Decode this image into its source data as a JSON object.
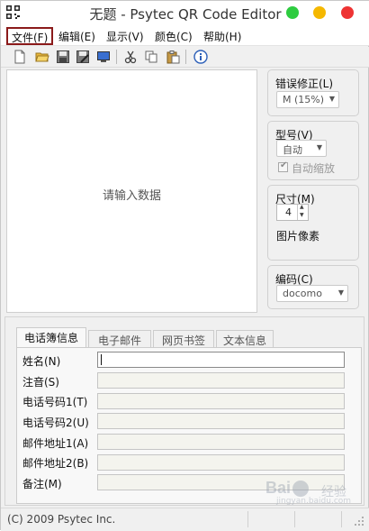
{
  "window": {
    "title": "无题 - Psytec QR Code Editor"
  },
  "menubar": {
    "file": "文件(F)",
    "edit": "编辑(E)",
    "view": "显示(V)",
    "color": "颜色(C)",
    "help": "帮助(H)"
  },
  "toolbar": {
    "icons": [
      "new-file-icon",
      "open-folder-icon",
      "save-icon",
      "save-as-icon",
      "monitor-icon",
      "cut-icon",
      "copy-icon",
      "paste-icon",
      "info-icon"
    ]
  },
  "preview": {
    "placeholder": "请输入数据"
  },
  "error_correction": {
    "title": "错误修正(L)",
    "value": "M (15%)"
  },
  "model": {
    "title": "型号(V)",
    "value": "自动",
    "auto_scale_label": "自动缩放",
    "auto_scale_checked": true
  },
  "size": {
    "title": "尺寸(M)",
    "value": "4",
    "unit_label": "图片像素"
  },
  "encoding": {
    "title": "编码(C)",
    "value": "docomo"
  },
  "tabs": [
    {
      "label": "电话簿信息",
      "active": true
    },
    {
      "label": "电子邮件",
      "active": false
    },
    {
      "label": "网页书签",
      "active": false
    },
    {
      "label": "文本信息",
      "active": false
    }
  ],
  "form": {
    "fields": [
      {
        "label": "姓名(N)",
        "value": ""
      },
      {
        "label": "注音(S)",
        "value": ""
      },
      {
        "label": "电话号码1(T)",
        "value": ""
      },
      {
        "label": "电话号码2(U)",
        "value": ""
      },
      {
        "label": "邮件地址1(A)",
        "value": ""
      },
      {
        "label": "邮件地址2(B)",
        "value": ""
      },
      {
        "label": "备注(M)",
        "value": ""
      }
    ]
  },
  "statusbar": {
    "text": "(C) 2009 Psytec Inc."
  },
  "watermark": {
    "logo": "Bai",
    "brand": "经验",
    "url": "jingyan.baidu.com"
  },
  "colors": {
    "file_menu_highlight": "#8b1a1a",
    "traffic_green": "#2ecc40",
    "traffic_yellow": "#f5b800",
    "traffic_red": "#ee3333"
  }
}
